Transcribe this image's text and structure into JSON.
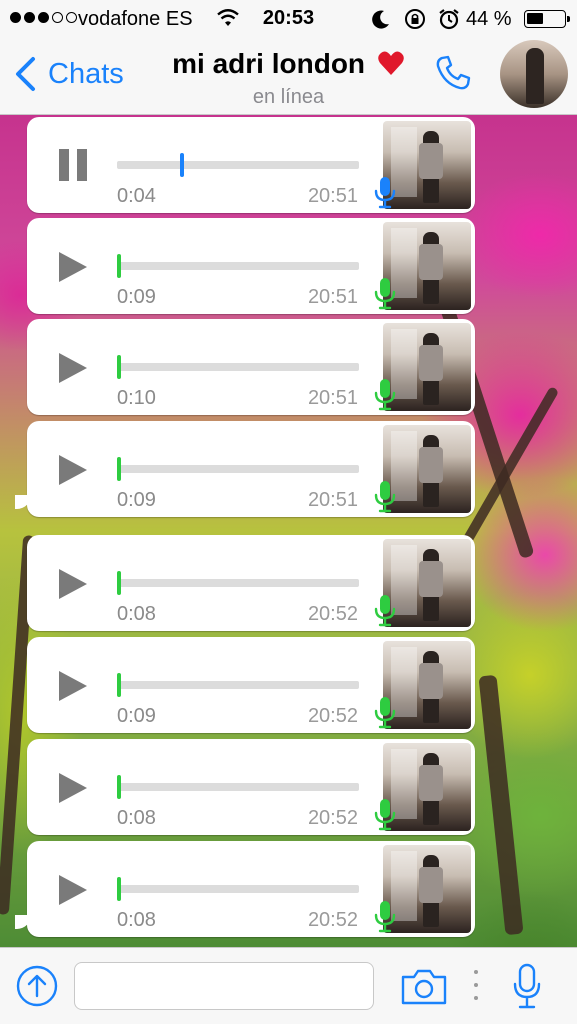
{
  "status_bar": {
    "carrier": "vodafone ES",
    "time": "20:53",
    "battery": "44 %",
    "battery_level": 0.44,
    "signal_bars": 3,
    "signal_total": 5
  },
  "nav": {
    "back_label": "Chats",
    "contact_name": "mi adri london",
    "contact_status": "en línea",
    "accent_color": "#1a82fb"
  },
  "messages": [
    {
      "duration": "0:04",
      "time": "20:51",
      "state": "playing",
      "progress": 0.26,
      "mic_color": "#1a82fb",
      "knob_color": "#1a82fb"
    },
    {
      "duration": "0:09",
      "time": "20:51",
      "state": "unplayed",
      "progress": 0,
      "mic_color": "#2ecc40",
      "knob_color": "#2ecc40"
    },
    {
      "duration": "0:10",
      "time": "20:51",
      "state": "unplayed",
      "progress": 0,
      "mic_color": "#2ecc40",
      "knob_color": "#2ecc40"
    },
    {
      "duration": "0:09",
      "time": "20:51",
      "state": "unplayed",
      "progress": 0,
      "mic_color": "#2ecc40",
      "knob_color": "#2ecc40"
    },
    {
      "duration": "0:08",
      "time": "20:52",
      "state": "unplayed",
      "progress": 0,
      "mic_color": "#2ecc40",
      "knob_color": "#2ecc40"
    },
    {
      "duration": "0:09",
      "time": "20:52",
      "state": "unplayed",
      "progress": 0,
      "mic_color": "#2ecc40",
      "knob_color": "#2ecc40"
    },
    {
      "duration": "0:08",
      "time": "20:52",
      "state": "unplayed",
      "progress": 0,
      "mic_color": "#2ecc40",
      "knob_color": "#2ecc40"
    },
    {
      "duration": "0:08",
      "time": "20:52",
      "state": "unplayed",
      "progress": 0,
      "mic_color": "#2ecc40",
      "knob_color": "#2ecc40"
    }
  ],
  "input_bar": {
    "placeholder": "",
    "icons": [
      "upload-icon",
      "camera-icon",
      "more-icon",
      "microphone-icon"
    ]
  }
}
